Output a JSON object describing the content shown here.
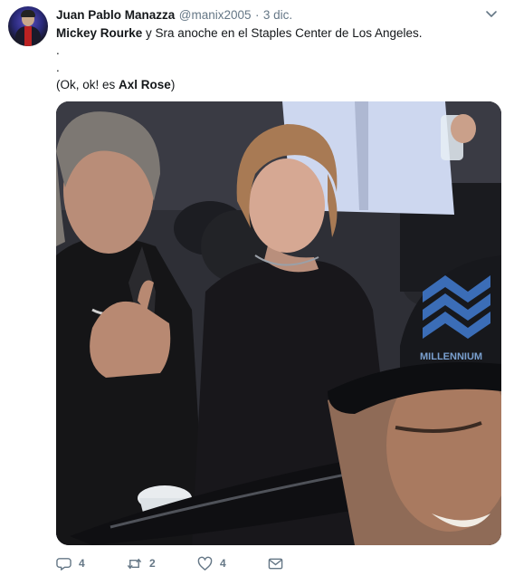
{
  "tweet": {
    "author_name": "Juan Pablo Manazza",
    "handle": "@manix2005",
    "separator": "·",
    "time": "3 dic.",
    "text": {
      "line1_bold": "Mickey Rourke",
      "line1_rest": " y Sra anoche en el Staples Center de Los Angeles.",
      "line2": ".",
      "line3": ".",
      "line4_start": "(Ok, ok! es ",
      "line4_bold": "Axl Rose",
      "line4_end": ")"
    },
    "photo_cap_text": "MILLENNIUM"
  },
  "actions": {
    "reply_count": "4",
    "retweet_count": "2",
    "like_count": "4"
  },
  "icons": {
    "menu": "chevron-down-icon",
    "reply": "reply-icon",
    "retweet": "retweet-icon",
    "like": "heart-icon",
    "dm": "envelope-icon"
  },
  "colors": {
    "name": "#14171a",
    "muted": "#657786",
    "icon": "#657786"
  }
}
